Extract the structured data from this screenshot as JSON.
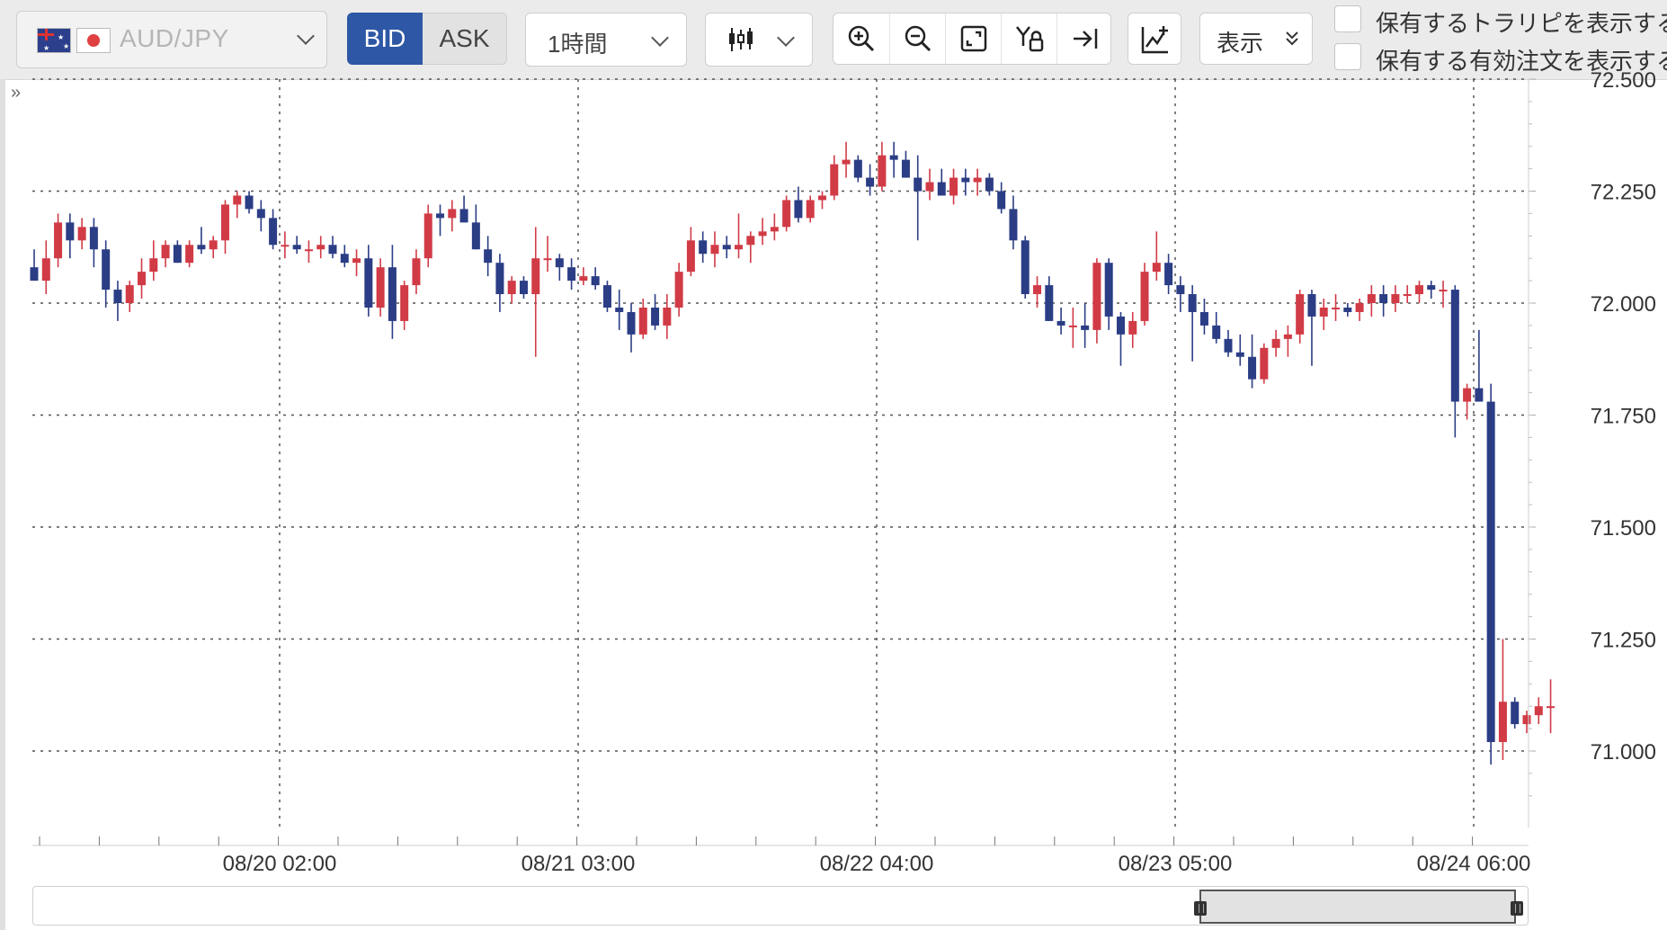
{
  "toolbar": {
    "pair_label": "AUD/JPY",
    "bid_label": "BID",
    "ask_label": "ASK",
    "period_label": "1時間",
    "display_label": "表示",
    "check_trap": "保有するトラリピを表示する",
    "check_orders": "保有する有効注文を表示する",
    "icons": [
      "zoom-in-icon",
      "zoom-out-icon",
      "fit-screen-icon",
      "y-axis-lock-icon",
      "jump-to-latest-icon",
      "add-indicator-icon",
      "candlestick-type-icon"
    ]
  },
  "colors": {
    "up": "#d13b46",
    "down": "#2b3d85",
    "accent": "#2e57a6",
    "grid": "#555555"
  },
  "chart_data": {
    "type": "candlestick",
    "symbol": "AUD/JPY",
    "side": "BID",
    "timeframe": "1時間",
    "y_ticks": [
      "72.500",
      "72.250",
      "72.000",
      "71.750",
      "71.500",
      "71.250",
      "71.000"
    ],
    "ylim": [
      70.84,
      72.5
    ],
    "x_labels": [
      "08/20 02:00",
      "08/21 03:00",
      "08/22 04:00",
      "08/23 05:00",
      "08/24 06:00"
    ],
    "grid": true,
    "candles": [
      [
        72.08,
        72.12,
        72.05,
        72.05
      ],
      [
        72.05,
        72.14,
        72.02,
        72.1
      ],
      [
        72.1,
        72.2,
        72.08,
        72.18
      ],
      [
        72.18,
        72.2,
        72.1,
        72.14
      ],
      [
        72.14,
        72.19,
        72.12,
        72.17
      ],
      [
        72.17,
        72.19,
        72.08,
        72.12
      ],
      [
        72.12,
        72.14,
        71.99,
        72.03
      ],
      [
        72.03,
        72.05,
        71.96,
        72.0
      ],
      [
        72.0,
        72.05,
        71.98,
        72.04
      ],
      [
        72.04,
        72.1,
        72.01,
        72.07
      ],
      [
        72.07,
        72.14,
        72.05,
        72.1
      ],
      [
        72.1,
        72.14,
        72.08,
        72.13
      ],
      [
        72.13,
        72.14,
        72.09,
        72.09
      ],
      [
        72.09,
        72.14,
        72.08,
        72.13
      ],
      [
        72.13,
        72.17,
        72.11,
        72.12
      ],
      [
        72.12,
        72.15,
        72.1,
        72.14
      ],
      [
        72.14,
        72.23,
        72.11,
        72.22
      ],
      [
        72.22,
        72.25,
        72.19,
        72.24
      ],
      [
        72.24,
        72.25,
        72.2,
        72.21
      ],
      [
        72.21,
        72.23,
        72.16,
        72.19
      ],
      [
        72.19,
        72.21,
        72.12,
        72.13
      ],
      [
        72.13,
        72.16,
        72.1,
        72.13
      ],
      [
        72.13,
        72.15,
        72.11,
        72.12
      ],
      [
        72.12,
        72.14,
        72.09,
        72.12
      ],
      [
        72.12,
        72.15,
        72.1,
        72.13
      ],
      [
        72.13,
        72.15,
        72.1,
        72.11
      ],
      [
        72.11,
        72.13,
        72.08,
        72.09
      ],
      [
        72.09,
        72.12,
        72.06,
        72.1
      ],
      [
        72.1,
        72.13,
        71.97,
        71.99
      ],
      [
        71.99,
        72.1,
        71.97,
        72.08
      ],
      [
        72.08,
        72.13,
        71.92,
        71.96
      ],
      [
        71.96,
        72.05,
        71.94,
        72.04
      ],
      [
        72.04,
        72.12,
        72.02,
        72.1
      ],
      [
        72.1,
        72.22,
        72.08,
        72.2
      ],
      [
        72.2,
        72.22,
        72.15,
        72.19
      ],
      [
        72.19,
        72.23,
        72.16,
        72.21
      ],
      [
        72.21,
        72.24,
        72.18,
        72.18
      ],
      [
        72.18,
        72.22,
        72.12,
        72.12
      ],
      [
        72.12,
        72.15,
        72.06,
        72.09
      ],
      [
        72.09,
        72.11,
        71.98,
        72.02
      ],
      [
        72.02,
        72.06,
        72.0,
        72.05
      ],
      [
        72.05,
        72.06,
        72.01,
        72.02
      ],
      [
        72.02,
        72.17,
        71.88,
        72.1
      ],
      [
        72.1,
        72.15,
        72.07,
        72.1
      ],
      [
        72.1,
        72.11,
        72.05,
        72.08
      ],
      [
        72.08,
        72.1,
        72.03,
        72.05
      ],
      [
        72.05,
        72.08,
        72.04,
        72.06
      ],
      [
        72.06,
        72.08,
        72.03,
        72.04
      ],
      [
        72.04,
        72.05,
        71.98,
        71.99
      ],
      [
        71.99,
        72.03,
        71.94,
        71.98
      ],
      [
        71.98,
        72.0,
        71.89,
        71.93
      ],
      [
        71.93,
        72.01,
        71.92,
        71.99
      ],
      [
        71.99,
        72.02,
        71.94,
        71.95
      ],
      [
        71.95,
        72.02,
        71.92,
        71.99
      ],
      [
        71.99,
        72.09,
        71.97,
        72.07
      ],
      [
        72.07,
        72.17,
        72.06,
        72.14
      ],
      [
        72.14,
        72.16,
        72.09,
        72.11
      ],
      [
        72.11,
        72.16,
        72.08,
        72.13
      ],
      [
        72.13,
        72.15,
        72.1,
        72.12
      ],
      [
        72.12,
        72.2,
        72.1,
        72.13
      ],
      [
        72.13,
        72.16,
        72.09,
        72.15
      ],
      [
        72.15,
        72.19,
        72.13,
        72.16
      ],
      [
        72.16,
        72.2,
        72.14,
        72.17
      ],
      [
        72.17,
        72.24,
        72.16,
        72.23
      ],
      [
        72.23,
        72.26,
        72.18,
        72.19
      ],
      [
        72.19,
        72.24,
        72.18,
        72.23
      ],
      [
        72.23,
        72.25,
        72.21,
        72.24
      ],
      [
        72.24,
        72.33,
        72.23,
        72.31
      ],
      [
        72.31,
        72.36,
        72.28,
        72.32
      ],
      [
        72.32,
        72.33,
        72.27,
        72.28
      ],
      [
        72.28,
        72.31,
        72.24,
        72.26
      ],
      [
        72.26,
        72.36,
        72.25,
        72.33
      ],
      [
        72.33,
        72.36,
        72.28,
        72.32
      ],
      [
        72.32,
        72.34,
        72.28,
        72.28
      ],
      [
        72.28,
        72.33,
        72.14,
        72.25
      ],
      [
        72.25,
        72.3,
        72.23,
        72.27
      ],
      [
        72.27,
        72.3,
        72.24,
        72.24
      ],
      [
        72.24,
        72.3,
        72.22,
        72.28
      ],
      [
        72.28,
        72.3,
        72.24,
        72.27
      ],
      [
        72.27,
        72.3,
        72.24,
        72.28
      ],
      [
        72.28,
        72.29,
        72.24,
        72.25
      ],
      [
        72.25,
        72.27,
        72.2,
        72.21
      ],
      [
        72.21,
        72.24,
        72.12,
        72.14
      ],
      [
        72.14,
        72.15,
        72.01,
        72.02
      ],
      [
        72.02,
        72.06,
        71.99,
        72.04
      ],
      [
        72.04,
        72.06,
        71.96,
        71.96
      ],
      [
        71.96,
        71.99,
        71.93,
        71.95
      ],
      [
        71.95,
        71.99,
        71.9,
        71.95
      ],
      [
        71.95,
        72.0,
        71.9,
        71.94
      ],
      [
        71.94,
        72.1,
        71.91,
        72.09
      ],
      [
        72.09,
        72.1,
        71.94,
        71.97
      ],
      [
        71.97,
        71.98,
        71.86,
        71.93
      ],
      [
        71.93,
        71.98,
        71.9,
        71.96
      ],
      [
        71.96,
        72.09,
        71.95,
        72.07
      ],
      [
        72.07,
        72.16,
        72.05,
        72.09
      ],
      [
        72.09,
        72.11,
        72.02,
        72.04
      ],
      [
        72.04,
        72.06,
        71.98,
        72.02
      ],
      [
        72.02,
        72.04,
        71.87,
        71.98
      ],
      [
        71.98,
        72.01,
        71.93,
        71.95
      ],
      [
        71.95,
        71.98,
        71.91,
        71.92
      ],
      [
        71.92,
        71.94,
        71.88,
        71.89
      ],
      [
        71.89,
        71.93,
        71.86,
        71.88
      ],
      [
        71.88,
        71.93,
        71.81,
        71.83
      ],
      [
        71.83,
        71.91,
        71.82,
        71.9
      ],
      [
        71.9,
        71.94,
        71.88,
        71.92
      ],
      [
        71.92,
        71.95,
        71.88,
        71.93
      ],
      [
        71.93,
        72.03,
        71.91,
        72.02
      ],
      [
        72.02,
        72.03,
        71.86,
        71.97
      ],
      [
        71.97,
        72.01,
        71.94,
        71.99
      ],
      [
        71.99,
        72.02,
        71.96,
        71.99
      ],
      [
        71.99,
        72.0,
        71.97,
        71.98
      ],
      [
        71.98,
        72.01,
        71.96,
        72.0
      ],
      [
        72.0,
        72.04,
        71.97,
        72.02
      ],
      [
        72.02,
        72.04,
        71.97,
        72.0
      ],
      [
        72.0,
        72.04,
        71.98,
        72.02
      ],
      [
        72.02,
        72.04,
        72.0,
        72.02
      ],
      [
        72.02,
        72.05,
        72.0,
        72.04
      ],
      [
        72.04,
        72.05,
        72.01,
        72.03
      ],
      [
        72.03,
        72.05,
        71.99,
        72.03
      ],
      [
        72.03,
        72.04,
        71.7,
        71.78
      ],
      [
        71.78,
        71.82,
        71.74,
        71.81
      ],
      [
        71.81,
        71.94,
        71.79,
        71.78
      ],
      [
        71.78,
        71.82,
        70.97,
        71.02
      ],
      [
        71.02,
        71.25,
        70.98,
        71.11
      ],
      [
        71.11,
        71.12,
        71.05,
        71.06
      ],
      [
        71.06,
        71.09,
        71.04,
        71.08
      ],
      [
        71.08,
        71.12,
        71.06,
        71.1
      ],
      [
        71.1,
        71.16,
        71.04,
        71.1
      ]
    ]
  }
}
